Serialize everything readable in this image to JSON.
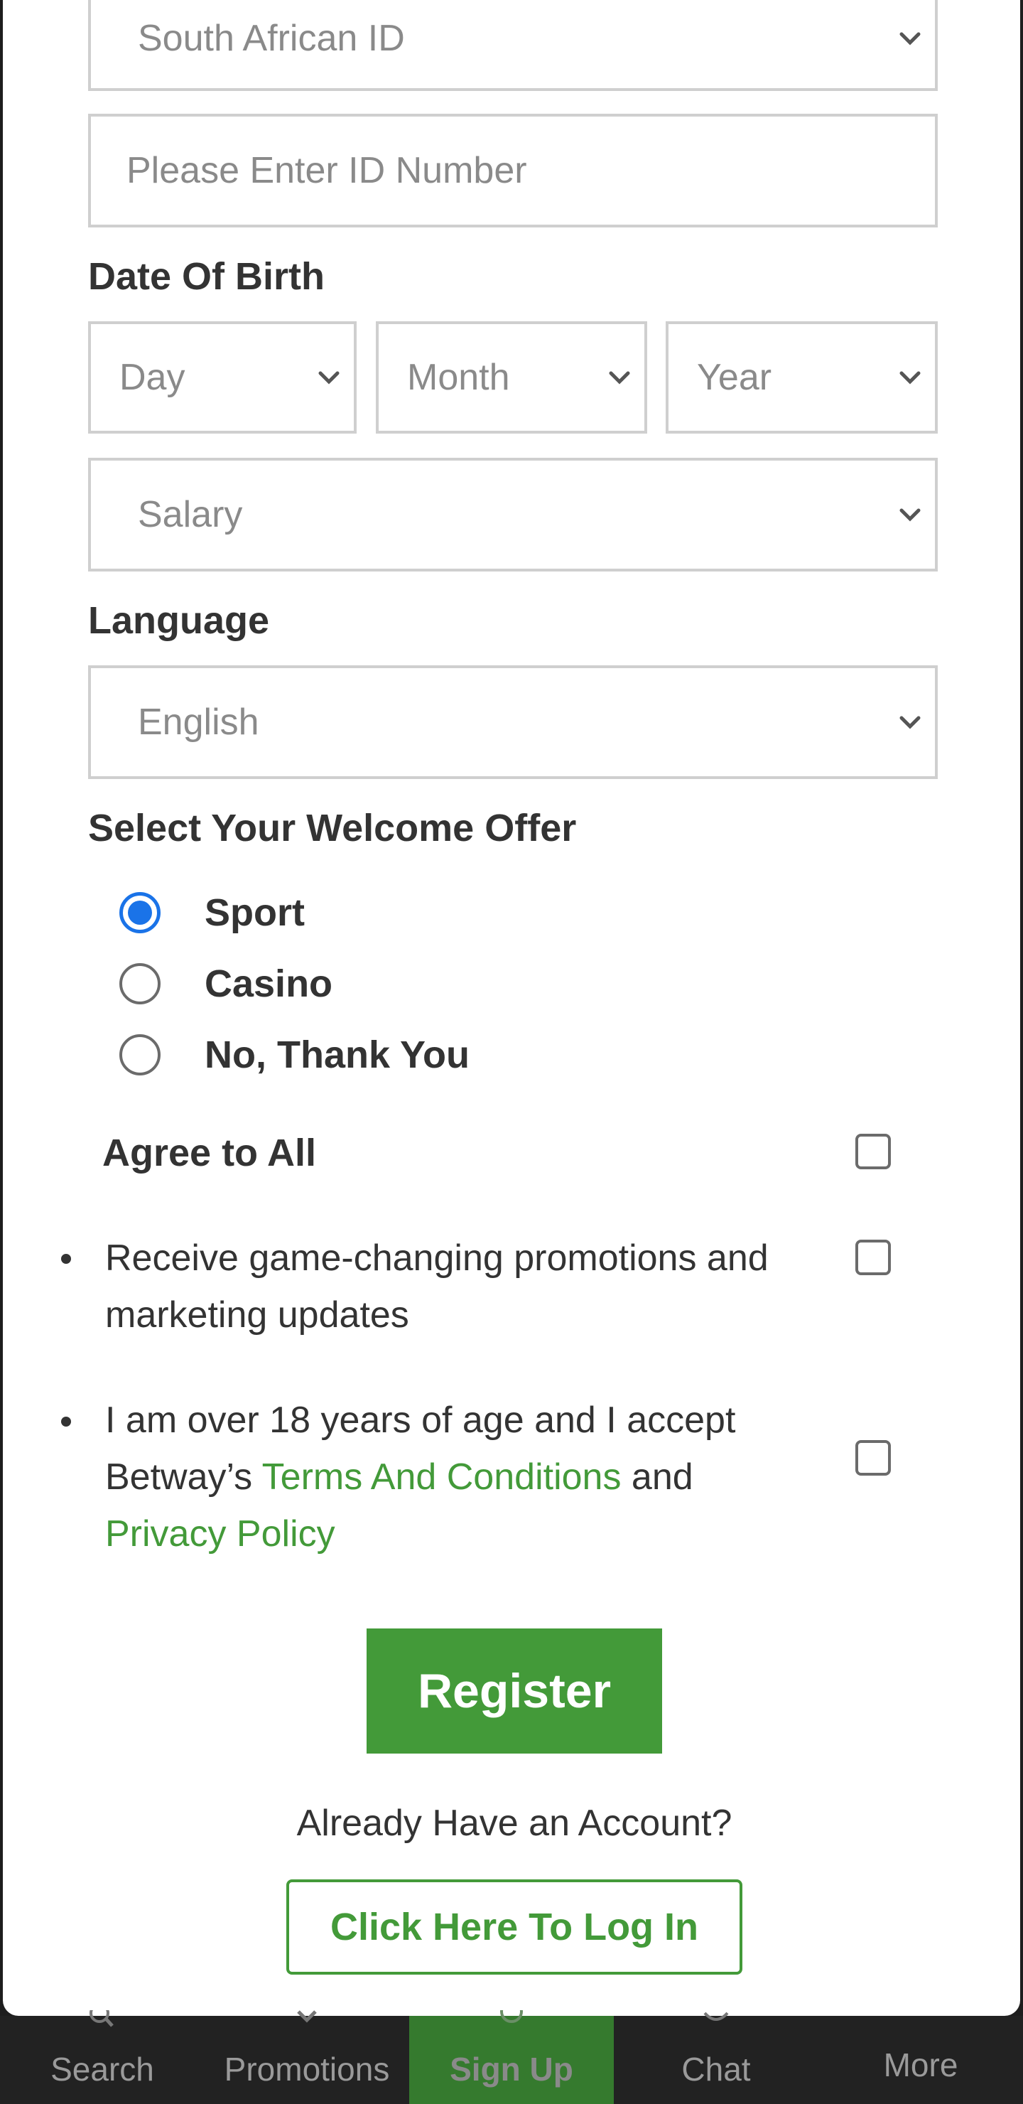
{
  "form": {
    "id_type": {
      "value": "South African ID"
    },
    "id_number": {
      "placeholder": "Please Enter ID Number"
    },
    "dob": {
      "label": "Date Of Birth",
      "day": "Day",
      "month": "Month",
      "year": "Year"
    },
    "salary": {
      "value": "Salary"
    },
    "language": {
      "label": "Language",
      "value": "English"
    },
    "welcome_offer": {
      "label": "Select Your Welcome Offer",
      "options": [
        {
          "label": "Sport",
          "checked": true
        },
        {
          "label": "Casino",
          "checked": false
        },
        {
          "label": "No, Thank You",
          "checked": false
        }
      ]
    },
    "consents": {
      "agree_all": "Agree to All",
      "promotions": "Receive game-changing promotions and marketing updates",
      "age_prefix": "I am over 18 years of age and I accept Betway’s ",
      "terms_link": "Terms And Conditions",
      "and": " and ",
      "privacy_link": "Privacy Policy"
    },
    "register_label": "Register",
    "already_text": "Already Have an Account?",
    "login_label": "Click Here To Log In"
  },
  "bottom_nav": {
    "items": [
      {
        "label": "Search",
        "icon": "search-icon"
      },
      {
        "label": "Promotions",
        "icon": "promotions-icon"
      },
      {
        "label": "Sign Up",
        "icon": "sign-up-icon",
        "active": true
      },
      {
        "label": "Chat",
        "icon": "chat-icon"
      },
      {
        "label": "More",
        "icon": "more-icon"
      }
    ]
  },
  "colors": {
    "brand_green": "#439a39",
    "radio_blue": "#1a73e8",
    "field_border": "#cfcfcf",
    "nav_bg": "#222222",
    "nav_active": "#357a2e"
  }
}
